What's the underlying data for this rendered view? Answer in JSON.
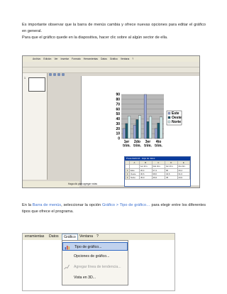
{
  "intro": {
    "line1": "Es importante observar que la barra de menús cambia y ofrece nuevas opciones para editar el gráfico en general.",
    "line2": "Para que el gráfico quede en la diapositiva, hacer clic sobre al algún sector de ella."
  },
  "shot1": {
    "menu": [
      "Archivo",
      "Edición",
      "Ver",
      "Insertar",
      "Formato",
      "Herramientas",
      "Datos",
      "Gráfico",
      "Ventana",
      "?"
    ],
    "slide_number": "1",
    "status_text": "Haga clic para agregar notas",
    "datasheet": {
      "title": "Presentación2 - Hoja de datos",
      "columns": [
        "",
        "A",
        "B",
        "C",
        "D",
        "E"
      ],
      "subheaders": [
        "",
        "",
        "1er trim.",
        "2do trim.",
        "3er trim.",
        "4to trim."
      ],
      "rows": [
        {
          "n": "1",
          "name": "Este",
          "v": [
            "20,4",
            "27,4",
            "90",
            "20,4"
          ]
        },
        {
          "n": "2",
          "name": "Oeste",
          "v": [
            "30,6",
            "38,6",
            "34,6",
            "31,6"
          ]
        },
        {
          "n": "3",
          "name": "Norte",
          "v": [
            "45,9",
            "46,9",
            "45",
            "43,9"
          ]
        }
      ]
    }
  },
  "chart_data": {
    "type": "bar",
    "categories": [
      "1er trim.",
      "2do trim.",
      "3er trim.",
      "4to trim."
    ],
    "category_lines": [
      [
        "1er",
        "trim."
      ],
      [
        "2do",
        "trim."
      ],
      [
        "3er",
        "trim."
      ],
      [
        "4to",
        "trim."
      ]
    ],
    "series": [
      {
        "name": "Este",
        "values": [
          20.4,
          27.4,
          90,
          20.4
        ],
        "color": "#9aa7d8"
      },
      {
        "name": "Oeste",
        "values": [
          30.6,
          38.6,
          34.6,
          31.6
        ],
        "color": "#1e5a6a"
      },
      {
        "name": "Norte",
        "values": [
          45.9,
          46.9,
          45,
          43.9
        ],
        "color": "#d9f2f2"
      }
    ],
    "yticks": [
      0,
      10,
      20,
      30,
      40,
      50,
      60,
      70,
      80,
      90
    ],
    "ylim": [
      0,
      90
    ],
    "legend": "right",
    "grid": true
  },
  "para2": {
    "pre": "En la ",
    "menu_bar": "Barra de menús",
    "mid": ", seleccionar la opción ",
    "path": "Gráfico > Tipo de gráfico…",
    "post": " para elegir entre los diferentes tipos que ofrece el programa."
  },
  "shot2": {
    "menu": [
      "erramientas",
      "Datos",
      "Gráfico",
      "Ventana",
      "?"
    ],
    "dropdown": [
      {
        "label": "Tipo de gráfico...",
        "state": "active",
        "icon": "chart-type-icon"
      },
      {
        "label": "Opciones de gráfico...",
        "state": "normal",
        "icon": ""
      },
      {
        "label": "Agregar línea de tendencia...",
        "state": "disabled",
        "icon": "trendline-icon"
      },
      {
        "label": "Vista en 3D...",
        "state": "normal",
        "icon": ""
      }
    ]
  }
}
